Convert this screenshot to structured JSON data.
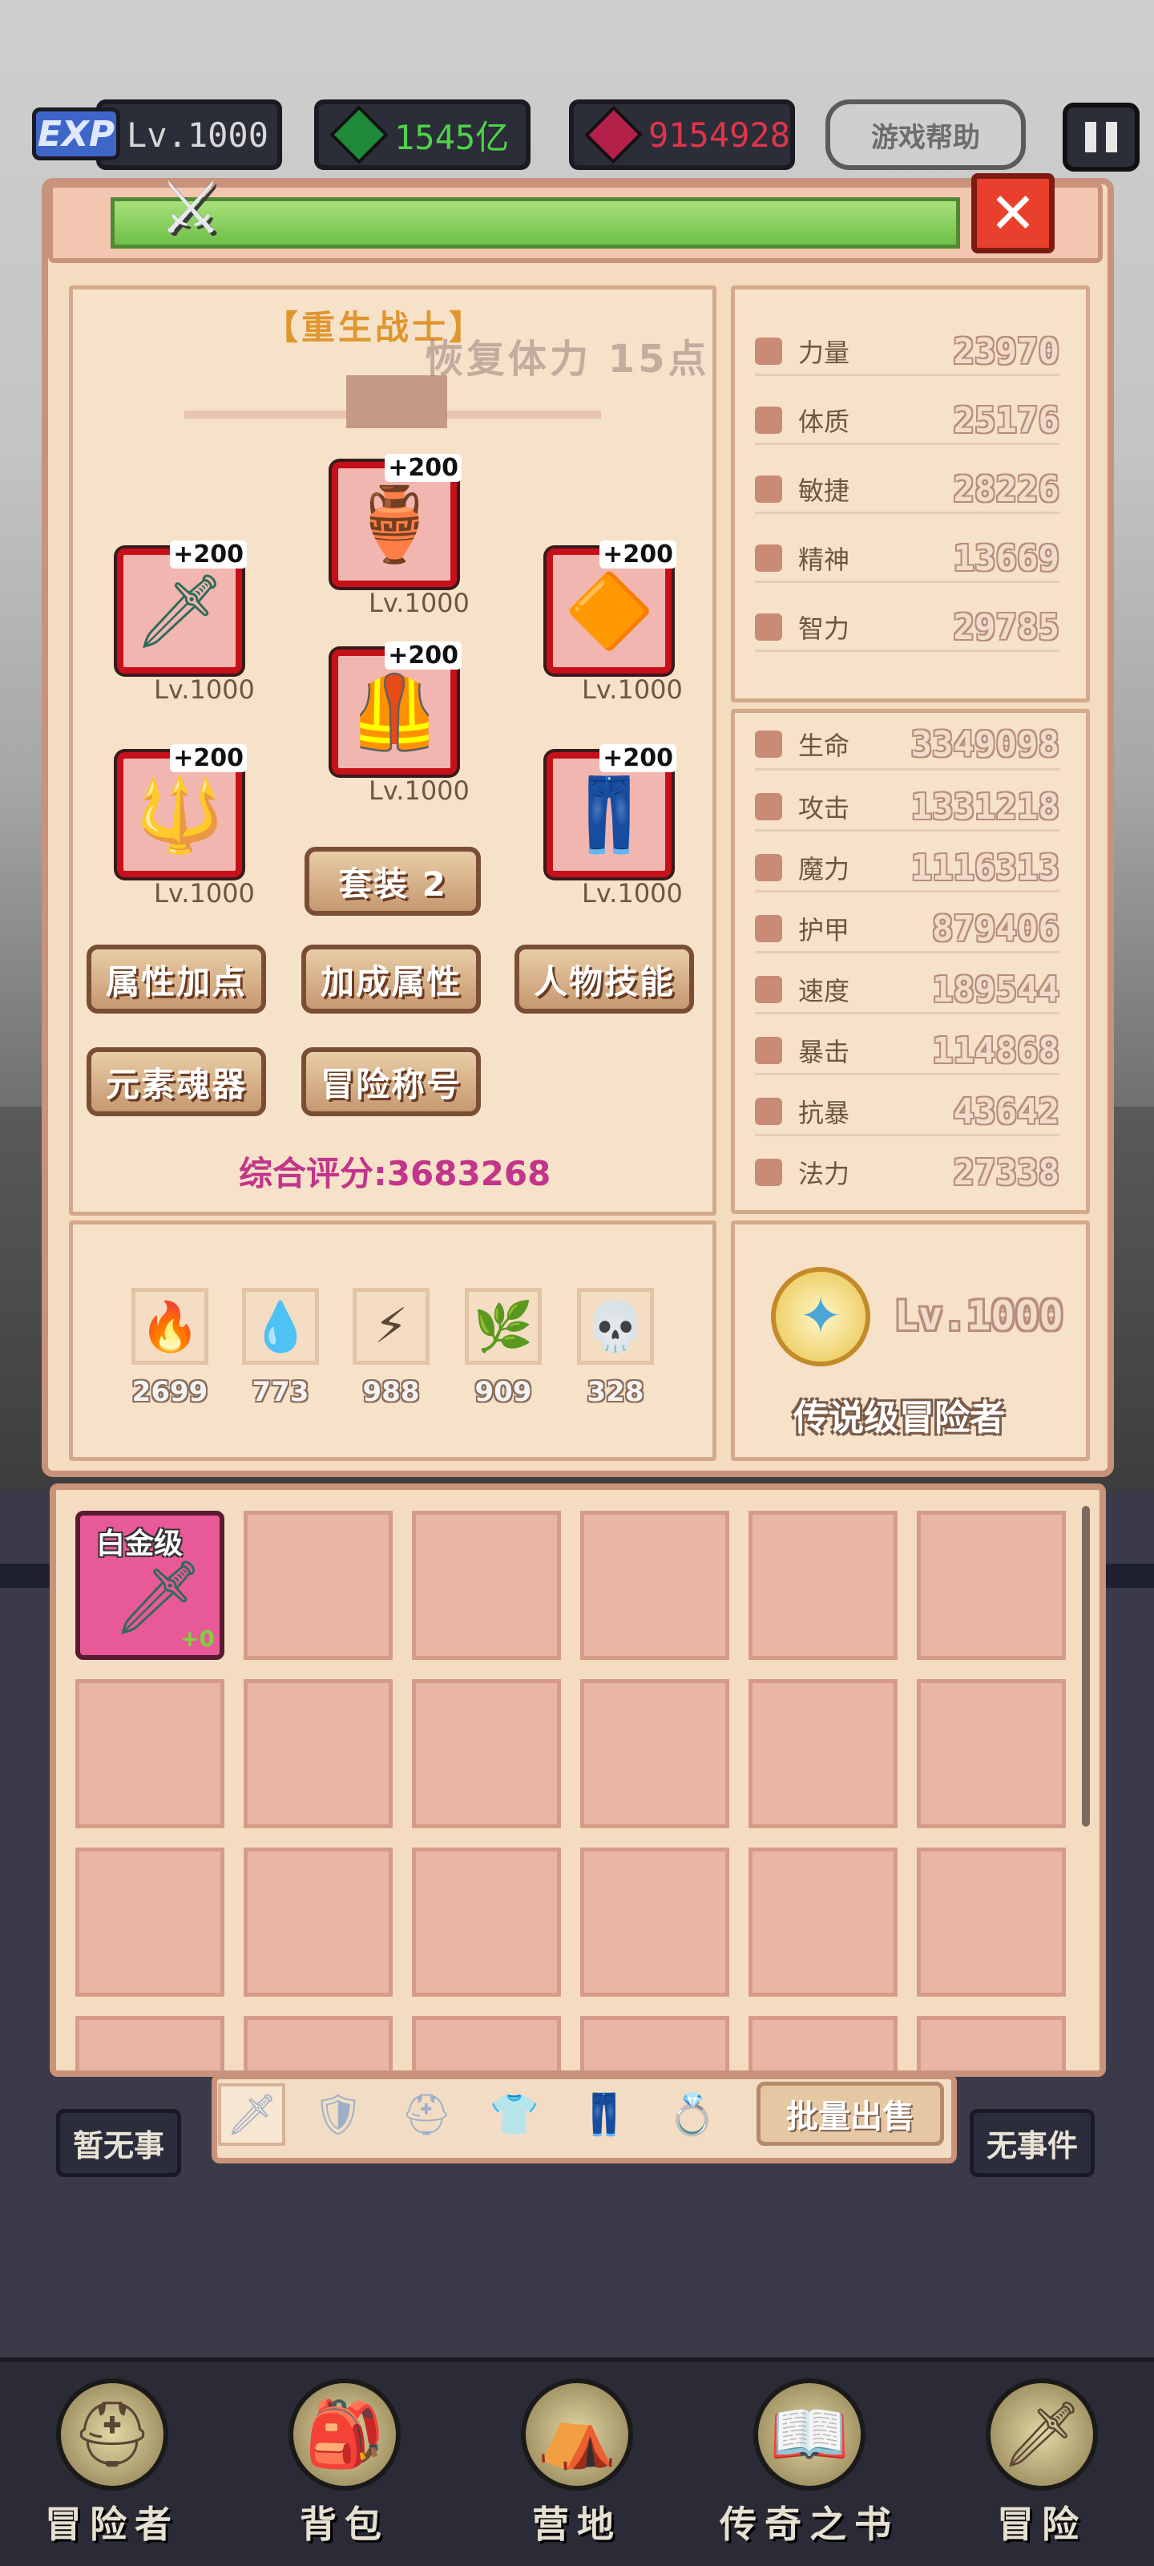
{
  "topbar": {
    "exp_badge": "EXP",
    "level": "Lv.1000",
    "green_currency": "1545亿",
    "red_currency": "9154928",
    "help": "游戏帮助",
    "colors": {
      "green_text": "#4fd24a",
      "red_text": "#e2344a"
    },
    "icons": [
      "exp-icon",
      "green-gem-icon",
      "red-gem-icon",
      "pause-icon"
    ]
  },
  "panel": {
    "char_title": "【重生战士】",
    "hp_recover_toast": "恢复体力 15点",
    "equipment": [
      {
        "slot": "top",
        "plus": "+200",
        "level": "Lv.1000",
        "icon": "helmet-icon"
      },
      {
        "slot": "left",
        "plus": "+200",
        "level": "Lv.1000",
        "icon": "sword-icon"
      },
      {
        "slot": "right",
        "plus": "+200",
        "level": "Lv.1000",
        "icon": "amulet-icon"
      },
      {
        "slot": "center",
        "plus": "+200",
        "level": "Lv.1000",
        "icon": "armor-icon"
      },
      {
        "slot": "bottom-left",
        "plus": "+200",
        "level": "Lv.1000",
        "icon": "spear-icon"
      },
      {
        "slot": "bottom-right",
        "plus": "+200",
        "level": "Lv.1000",
        "icon": "leggings-icon"
      }
    ],
    "set_button": "套装 2",
    "buttons": [
      "属性加点",
      "加成属性",
      "人物技能",
      "元素魂器",
      "冒险称号"
    ],
    "score": "综合评分:3683268",
    "elements": [
      {
        "icon": "fire-icon",
        "value": "2699"
      },
      {
        "icon": "water-icon",
        "value": "773"
      },
      {
        "icon": "lightning-icon",
        "value": "988"
      },
      {
        "icon": "nature-icon",
        "value": "909"
      },
      {
        "icon": "skull-icon",
        "value": "328"
      }
    ]
  },
  "stats_base": [
    {
      "label": "力量",
      "value": "23970"
    },
    {
      "label": "体质",
      "value": "25176"
    },
    {
      "label": "敏捷",
      "value": "28226"
    },
    {
      "label": "精神",
      "value": "13669"
    },
    {
      "label": "智力",
      "value": "29785"
    }
  ],
  "stats_combat": [
    {
      "label": "生命",
      "value": "3349098"
    },
    {
      "label": "攻击",
      "value": "1331218"
    },
    {
      "label": "魔力",
      "value": "1116313"
    },
    {
      "label": "护甲",
      "value": "879406"
    },
    {
      "label": "速度",
      "value": "189544"
    },
    {
      "label": "暴击",
      "value": "114868"
    },
    {
      "label": "抗暴",
      "value": "43642"
    },
    {
      "label": "法力",
      "value": "27338"
    }
  ],
  "rank": {
    "level": "Lv.1000",
    "title": "传说级冒险者"
  },
  "inventory": {
    "first_item": {
      "tier": "白金级",
      "plus": "+0",
      "icon": "sword-icon"
    }
  },
  "bag_tabs": {
    "bulk_sell": "批量出售",
    "tab_icons": [
      "sword-tab-icon",
      "shield-tab-icon",
      "helmet-tab-icon",
      "armor-tab-icon",
      "pants-tab-icon",
      "ring-tab-icon"
    ]
  },
  "side_labels": {
    "left": "暂无事",
    "right": "无事件"
  },
  "nav": [
    {
      "label": "冒险者",
      "icon": "adventurer-icon"
    },
    {
      "label": "背包",
      "icon": "backpack-icon"
    },
    {
      "label": "营地",
      "icon": "camp-icon"
    },
    {
      "label": "传奇之书",
      "icon": "legend-book-icon"
    },
    {
      "label": "冒险",
      "icon": "adventure-sword-icon"
    }
  ]
}
